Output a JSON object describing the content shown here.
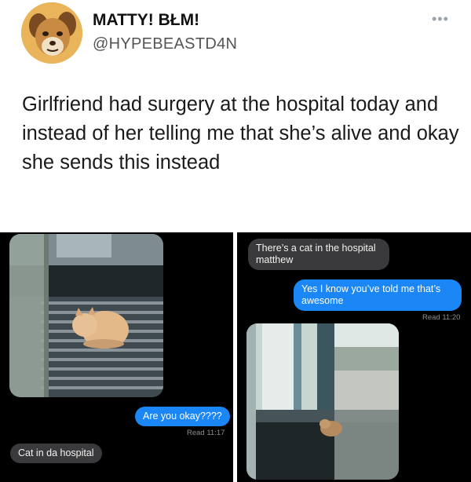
{
  "tweet": {
    "display_name": "MATTY! BŁM!",
    "handle": "@HYPEBEASTD4N",
    "more_icon": "more-dots-icon",
    "text": "Girlfriend had surgery at the hospital today and instead of her telling me that she’s alive and okay she sends this instead"
  },
  "left_chat": {
    "photo_icon": "cat-photo",
    "outgoing_message": "Are you okay????",
    "read_receipt": "Read 11:17",
    "incoming_message": "Cat in da hospital"
  },
  "right_chat": {
    "incoming_message": "There’s a cat in the hospital matthew",
    "outgoing_message": "Yes I know you’ve told me that’s awesome",
    "read_receipt": "Read 11:20",
    "photo_icon": "cat-window-photo"
  },
  "colors": {
    "outgoing_bubble": "#1b86f5",
    "incoming_bubble": "#3a3a3c",
    "chat_background": "#000000"
  }
}
